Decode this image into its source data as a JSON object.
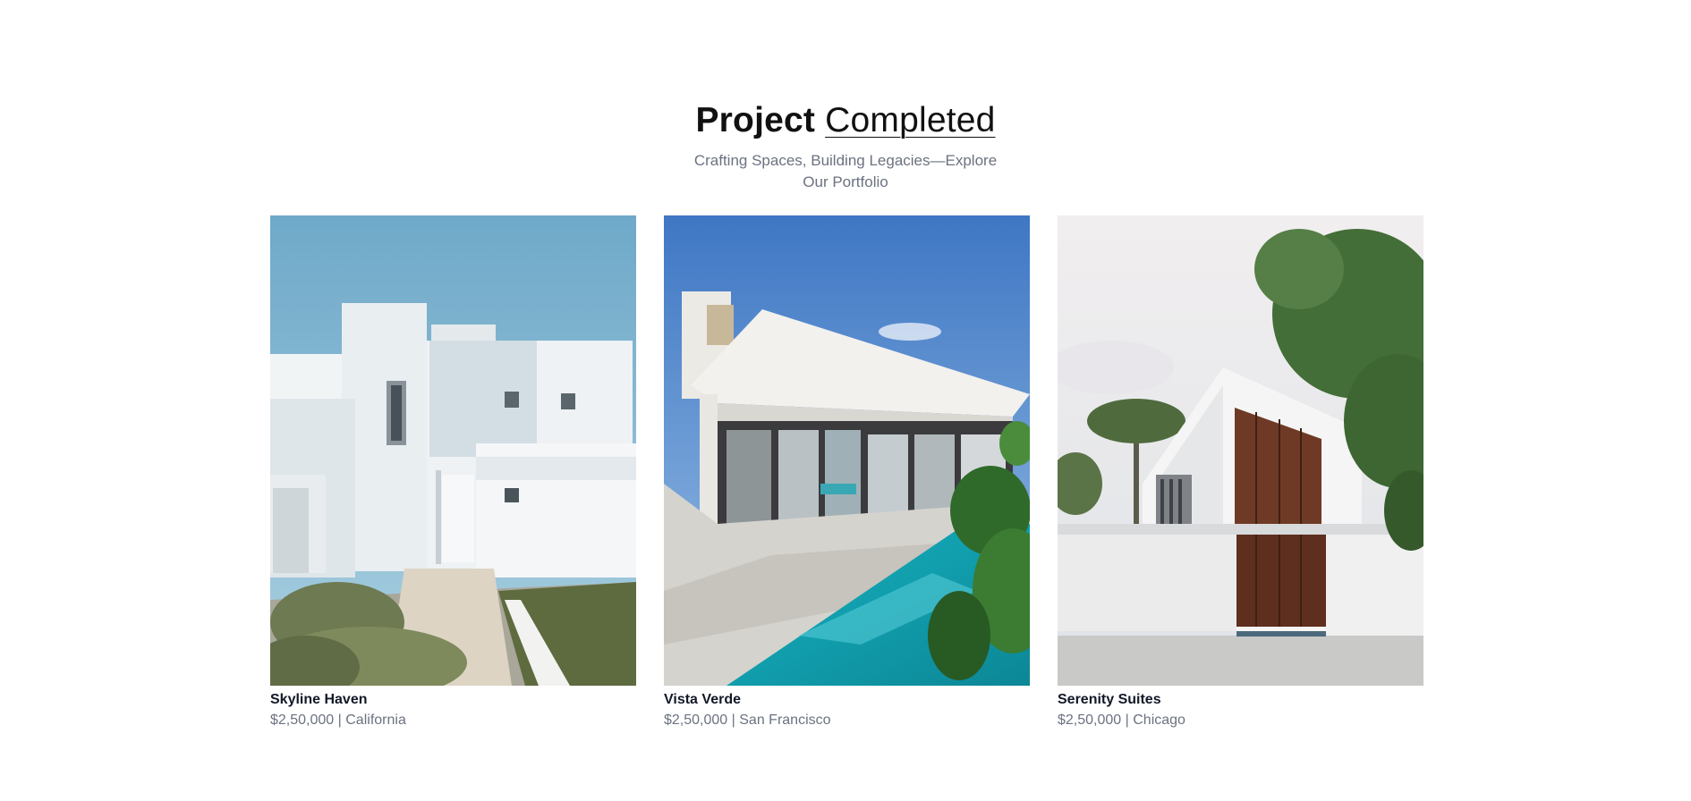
{
  "header": {
    "title_strong": "Project",
    "title_light": "Completed",
    "subtitle": "Crafting Spaces, Building Legacies—Explore Our Portfolio"
  },
  "projects": [
    {
      "name": "Skyline Haven",
      "price": "$2,50,000",
      "separator": "|",
      "location": "California",
      "image": "white-modern-house-photo"
    },
    {
      "name": "Vista Verde",
      "price": "$2,50,000",
      "separator": "|",
      "location": "San Francisco",
      "image": "house-with-pool-photo"
    },
    {
      "name": "Serenity Suites",
      "price": "$2,50,000",
      "separator": "|",
      "location": "Chicago",
      "image": "house-with-wood-panels-photo"
    }
  ],
  "colors": {
    "title": "#111111",
    "subtitle": "#6b7280",
    "card_name": "#111827",
    "card_meta": "#6b7280",
    "background": "#ffffff"
  }
}
